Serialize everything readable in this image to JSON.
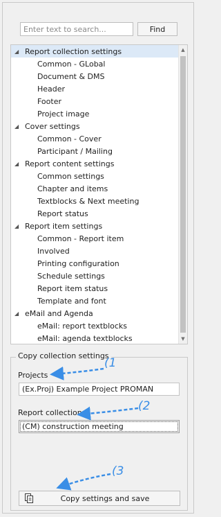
{
  "search": {
    "placeholder": "Enter text to search...",
    "value": "",
    "button_label": "Find"
  },
  "tree": {
    "categories": [
      {
        "label": "Report collection settings",
        "expanded": true,
        "selected": true,
        "children": [
          "Common - GLobal",
          "Document & DMS",
          "Header",
          "Footer",
          "Project image"
        ]
      },
      {
        "label": "Cover settings",
        "expanded": true,
        "children": [
          "Common - Cover",
          "Participant / Mailing"
        ]
      },
      {
        "label": "Report content settings",
        "expanded": true,
        "children": [
          "Common settings",
          "Chapter and items",
          "Textblocks & Next meeting",
          "Report status"
        ]
      },
      {
        "label": "Report item settings",
        "expanded": true,
        "children": [
          "Common - Report item",
          "Involved",
          "Printing configuration",
          "Schedule settings",
          "Report item status",
          "Template and font"
        ]
      },
      {
        "label": "eMail and Agenda",
        "expanded": true,
        "children": [
          "eMail: report textblocks",
          "eMail: agenda textblocks"
        ]
      }
    ]
  },
  "copy_group": {
    "title": "Copy collection settings",
    "projects_label": "Projects",
    "projects_value": "(Ex.Proj) Example Project PROMAN",
    "collections_label": "Report collections",
    "collections_value": "(CM) construction meeting",
    "button_label": "Copy settings and save",
    "button_icon": "copy-icon"
  },
  "annotations": {
    "callout_1": "(1",
    "callout_2": "(2",
    "callout_3": "(3",
    "color": "#3a8ee6"
  },
  "colors": {
    "selected_row": "#dce9f7",
    "panel_bg": "#f0f0f0"
  }
}
